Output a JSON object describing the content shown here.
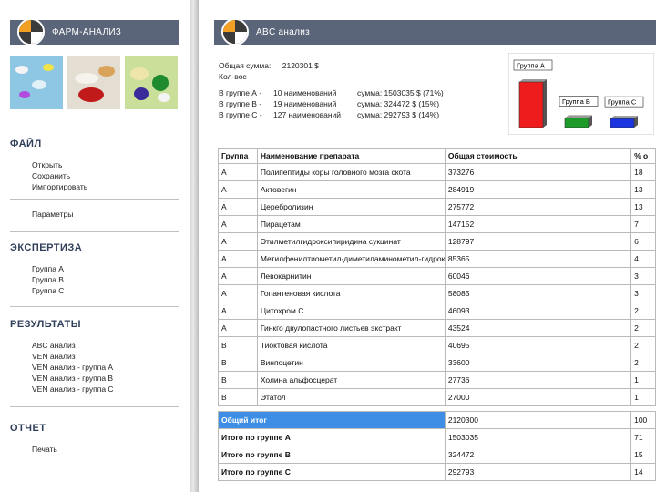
{
  "sidebar": {
    "title": "ФАРМ-АНАЛИЗ",
    "sections": [
      {
        "title": "ФАЙЛ",
        "items": [
          "Открыть",
          "Сохранить",
          "Импортировать"
        ],
        "extra": [
          "Параметры"
        ]
      },
      {
        "title": "ЭКСПЕРТИЗА",
        "items": [
          "Группа А",
          "Группа В",
          "Группа С"
        ]
      },
      {
        "title": "РЕЗУЛЬТАТЫ",
        "items": [
          "ABC анализ",
          "VEN анализ",
          "VEN анализ - группа А",
          "VEN анализ - группа В",
          "VEN анализ - группа С"
        ]
      },
      {
        "title": "ОТЧЕТ",
        "items": [
          "Печать"
        ]
      }
    ]
  },
  "main": {
    "title": "ABC анализ",
    "summary": {
      "total_label": "Общая сумма:",
      "total_value": "2120301 $",
      "count_label": "Кол-вос",
      "lines": [
        {
          "group": "В группе А -",
          "count": "10 наименований",
          "sum": "сумма: 1503035 $ (71%)"
        },
        {
          "group": "В группе В -",
          "count": "19 наименований",
          "sum": "сумма: 324472 $ (15%)"
        },
        {
          "group": "В группе С -",
          "count": "127 наименований",
          "sum": "сумма: 292793 $ (14%)"
        }
      ]
    },
    "chart_data": {
      "type": "bar",
      "categories": [
        "Группа А",
        "Группа В",
        "Группа С"
      ],
      "values": [
        71,
        15,
        14
      ],
      "colors": [
        "#ee1c1c",
        "#1e9a2a",
        "#1a35e0"
      ]
    },
    "table": {
      "columns": [
        "Группа",
        "Наименование препарата",
        "Общая стоимость",
        "% о"
      ],
      "rows": [
        [
          "А",
          "Полипептиды коры головного мозга скота",
          "373276",
          "18"
        ],
        [
          "А",
          "Актовегин",
          "284919",
          "13"
        ],
        [
          "А",
          "Церебролизин",
          "275772",
          "13"
        ],
        [
          "А",
          "Пирацетам",
          "147152",
          "7"
        ],
        [
          "А",
          "Этилметилгидроксипиридина сукцинат",
          "128797",
          "6"
        ],
        [
          "А",
          "Метилфенилтиометил-диметиламинометил-гидроксиброминдол",
          "85365",
          "4"
        ],
        [
          "А",
          "Левокарнитин",
          "60046",
          "3"
        ],
        [
          "А",
          "Гопантеновая кислота",
          "58085",
          "3"
        ],
        [
          "А",
          "Цитохром С",
          "46093",
          "2"
        ],
        [
          "А",
          "Гинкго двулопастного листьев экстракт",
          "43524",
          "2"
        ],
        [
          "В",
          "Тиоктовая кислота",
          "40695",
          "2"
        ],
        [
          "В",
          "Винпоцетин",
          "33600",
          "2"
        ],
        [
          "В",
          "Холина альфосцерат",
          "27736",
          "1"
        ],
        [
          "В",
          "Этатол",
          "27000",
          "1"
        ]
      ],
      "totals": [
        {
          "label": "Общий итог",
          "value": "2120300",
          "pct": "100"
        },
        {
          "label": "Итого по группе А",
          "value": "1503035",
          "pct": "71"
        },
        {
          "label": "Итого по группе В",
          "value": "324472",
          "pct": "15"
        },
        {
          "label": "Итого по группе С",
          "value": "292793",
          "pct": "14"
        }
      ]
    }
  }
}
